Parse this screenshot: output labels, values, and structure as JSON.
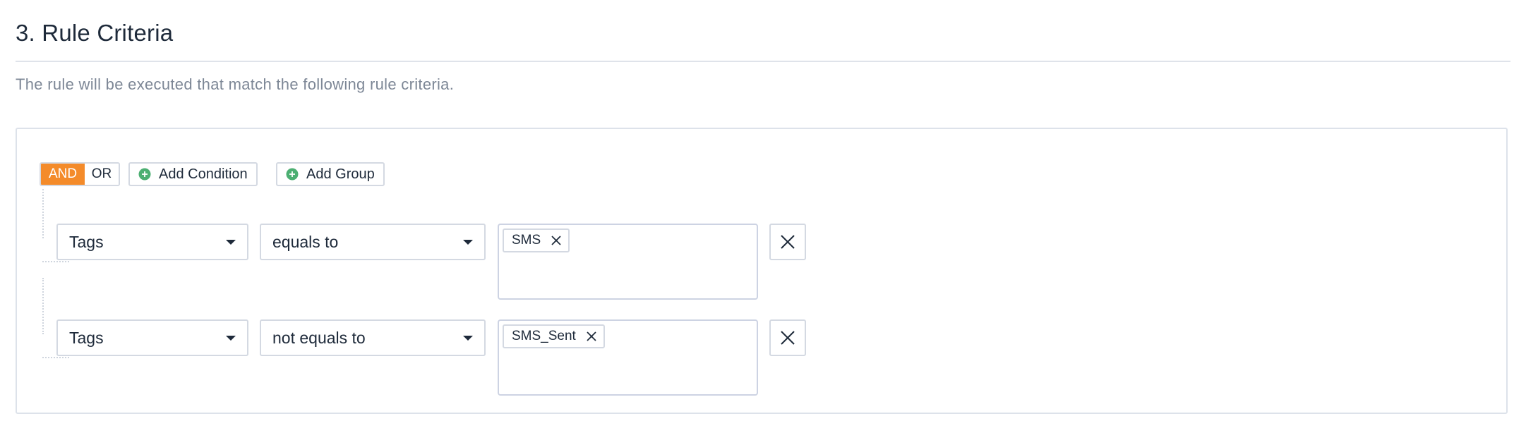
{
  "section": {
    "title": "3. Rule Criteria",
    "description": "The rule will be executed that match the following rule criteria."
  },
  "toolbar": {
    "and_label": "AND",
    "or_label": "OR",
    "add_condition_label": "Add Condition",
    "add_group_label": "Add Group",
    "active_operator": "AND"
  },
  "conditions": [
    {
      "field": "Tags",
      "operator": "equals to",
      "values": [
        "SMS"
      ]
    },
    {
      "field": "Tags",
      "operator": "not equals to",
      "values": [
        "SMS_Sent"
      ]
    }
  ],
  "colors": {
    "accent": "#f48b2a",
    "add_icon": "#4caf72",
    "border": "#d4d9e2",
    "muted_text": "#7d8796"
  },
  "icons": {
    "add": "plus-circle-icon",
    "dropdown": "caret-down-icon",
    "remove_value": "close-icon",
    "remove_condition": "close-icon"
  }
}
